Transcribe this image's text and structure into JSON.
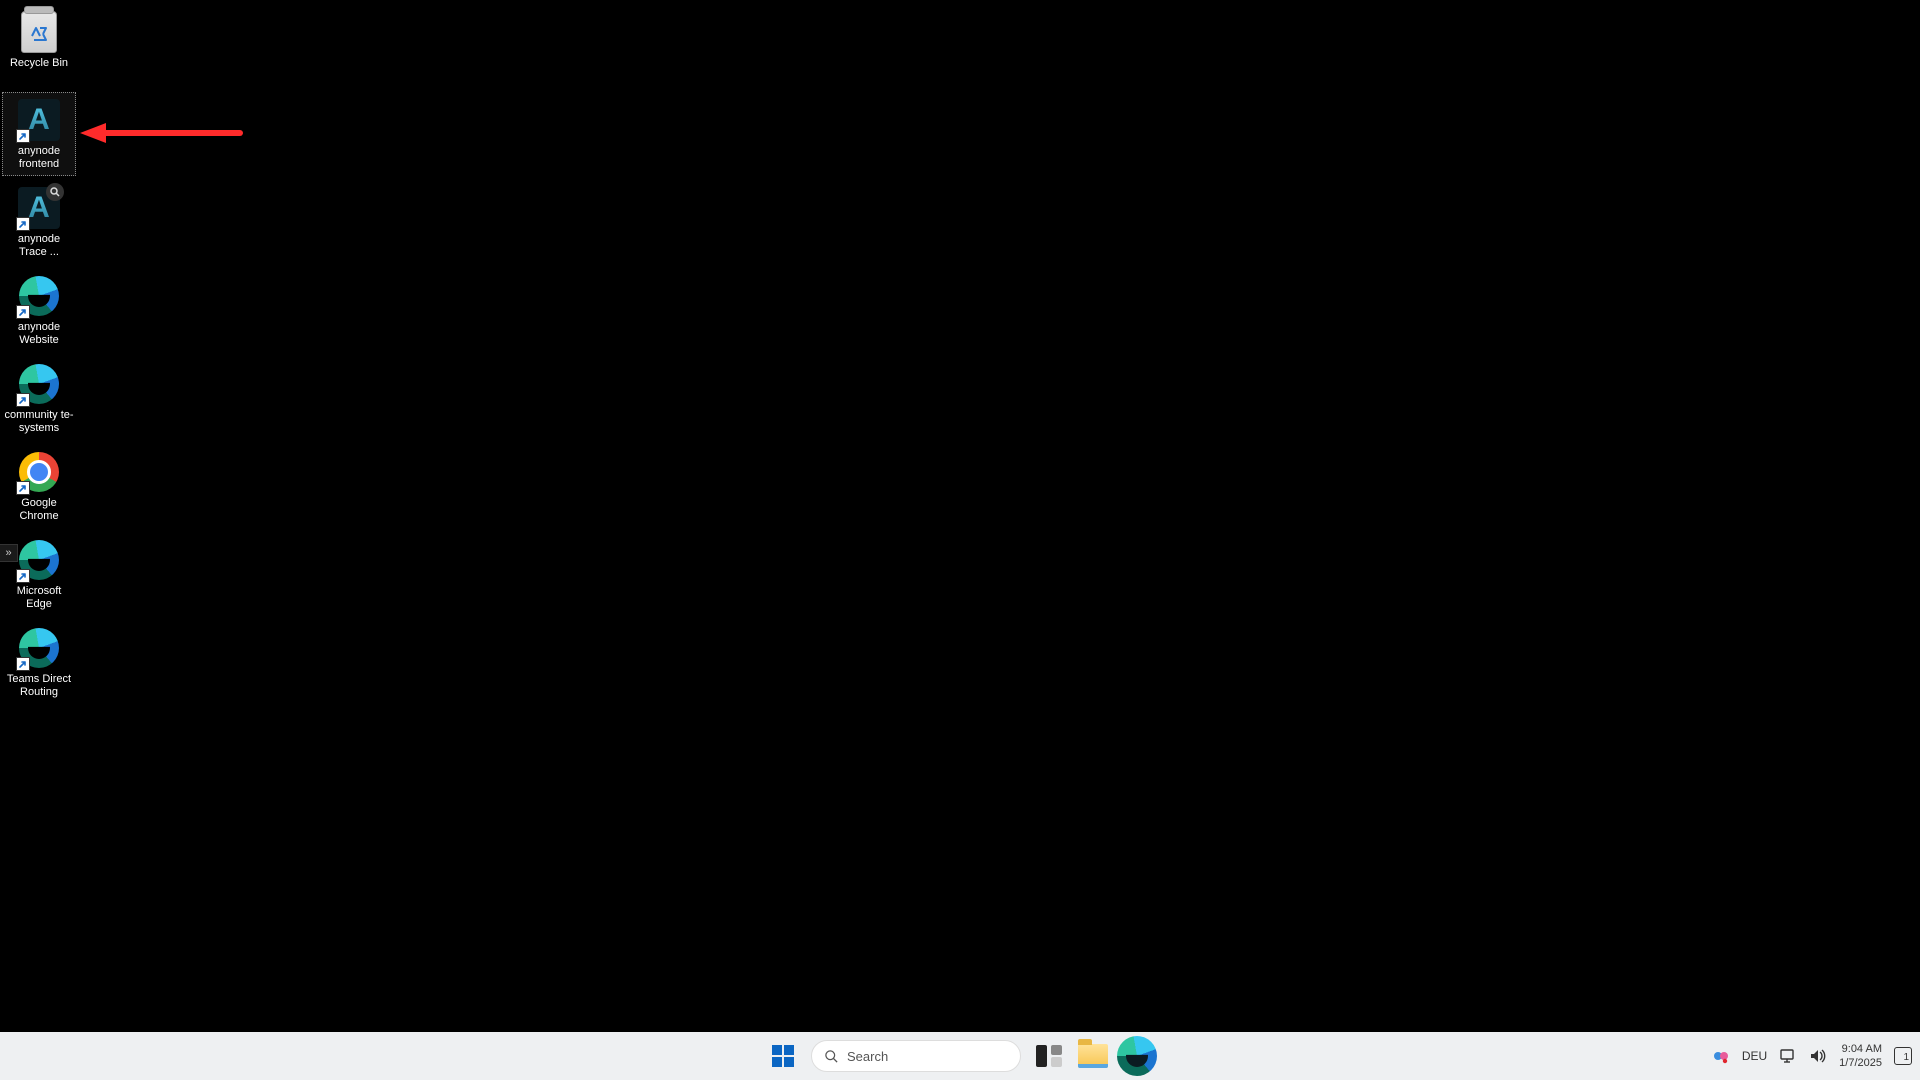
{
  "desktop": {
    "icons": [
      {
        "name": "recycle-bin",
        "label": "Recycle Bin",
        "type": "recycle",
        "shortcut": false,
        "selected": false
      },
      {
        "name": "anynode-frontend",
        "label": "anynode frontend",
        "type": "anynode",
        "shortcut": true,
        "selected": true
      },
      {
        "name": "anynode-trace",
        "label": "anynode Trace ...",
        "type": "anynode-mag",
        "shortcut": true,
        "selected": false
      },
      {
        "name": "anynode-website",
        "label": "anynode Website",
        "type": "edge",
        "shortcut": true,
        "selected": false
      },
      {
        "name": "community-te-systems",
        "label": "community te-systems",
        "type": "edge",
        "shortcut": true,
        "selected": false
      },
      {
        "name": "google-chrome",
        "label": "Google Chrome",
        "type": "chrome",
        "shortcut": true,
        "selected": false
      },
      {
        "name": "microsoft-edge",
        "label": "Microsoft Edge",
        "type": "edge",
        "shortcut": true,
        "selected": false
      },
      {
        "name": "teams-direct-routing",
        "label": "Teams Direct Routing",
        "type": "edge",
        "shortcut": true,
        "selected": false
      }
    ]
  },
  "taskbar": {
    "search_placeholder": "Search",
    "pinned": [
      {
        "name": "task-view",
        "type": "taskview"
      },
      {
        "name": "file-explorer",
        "type": "folder"
      },
      {
        "name": "edge",
        "type": "edge"
      }
    ],
    "tray": {
      "language": "DEU",
      "time": "9:04 AM",
      "date": "1/7/2025",
      "notification_count": "1"
    }
  }
}
